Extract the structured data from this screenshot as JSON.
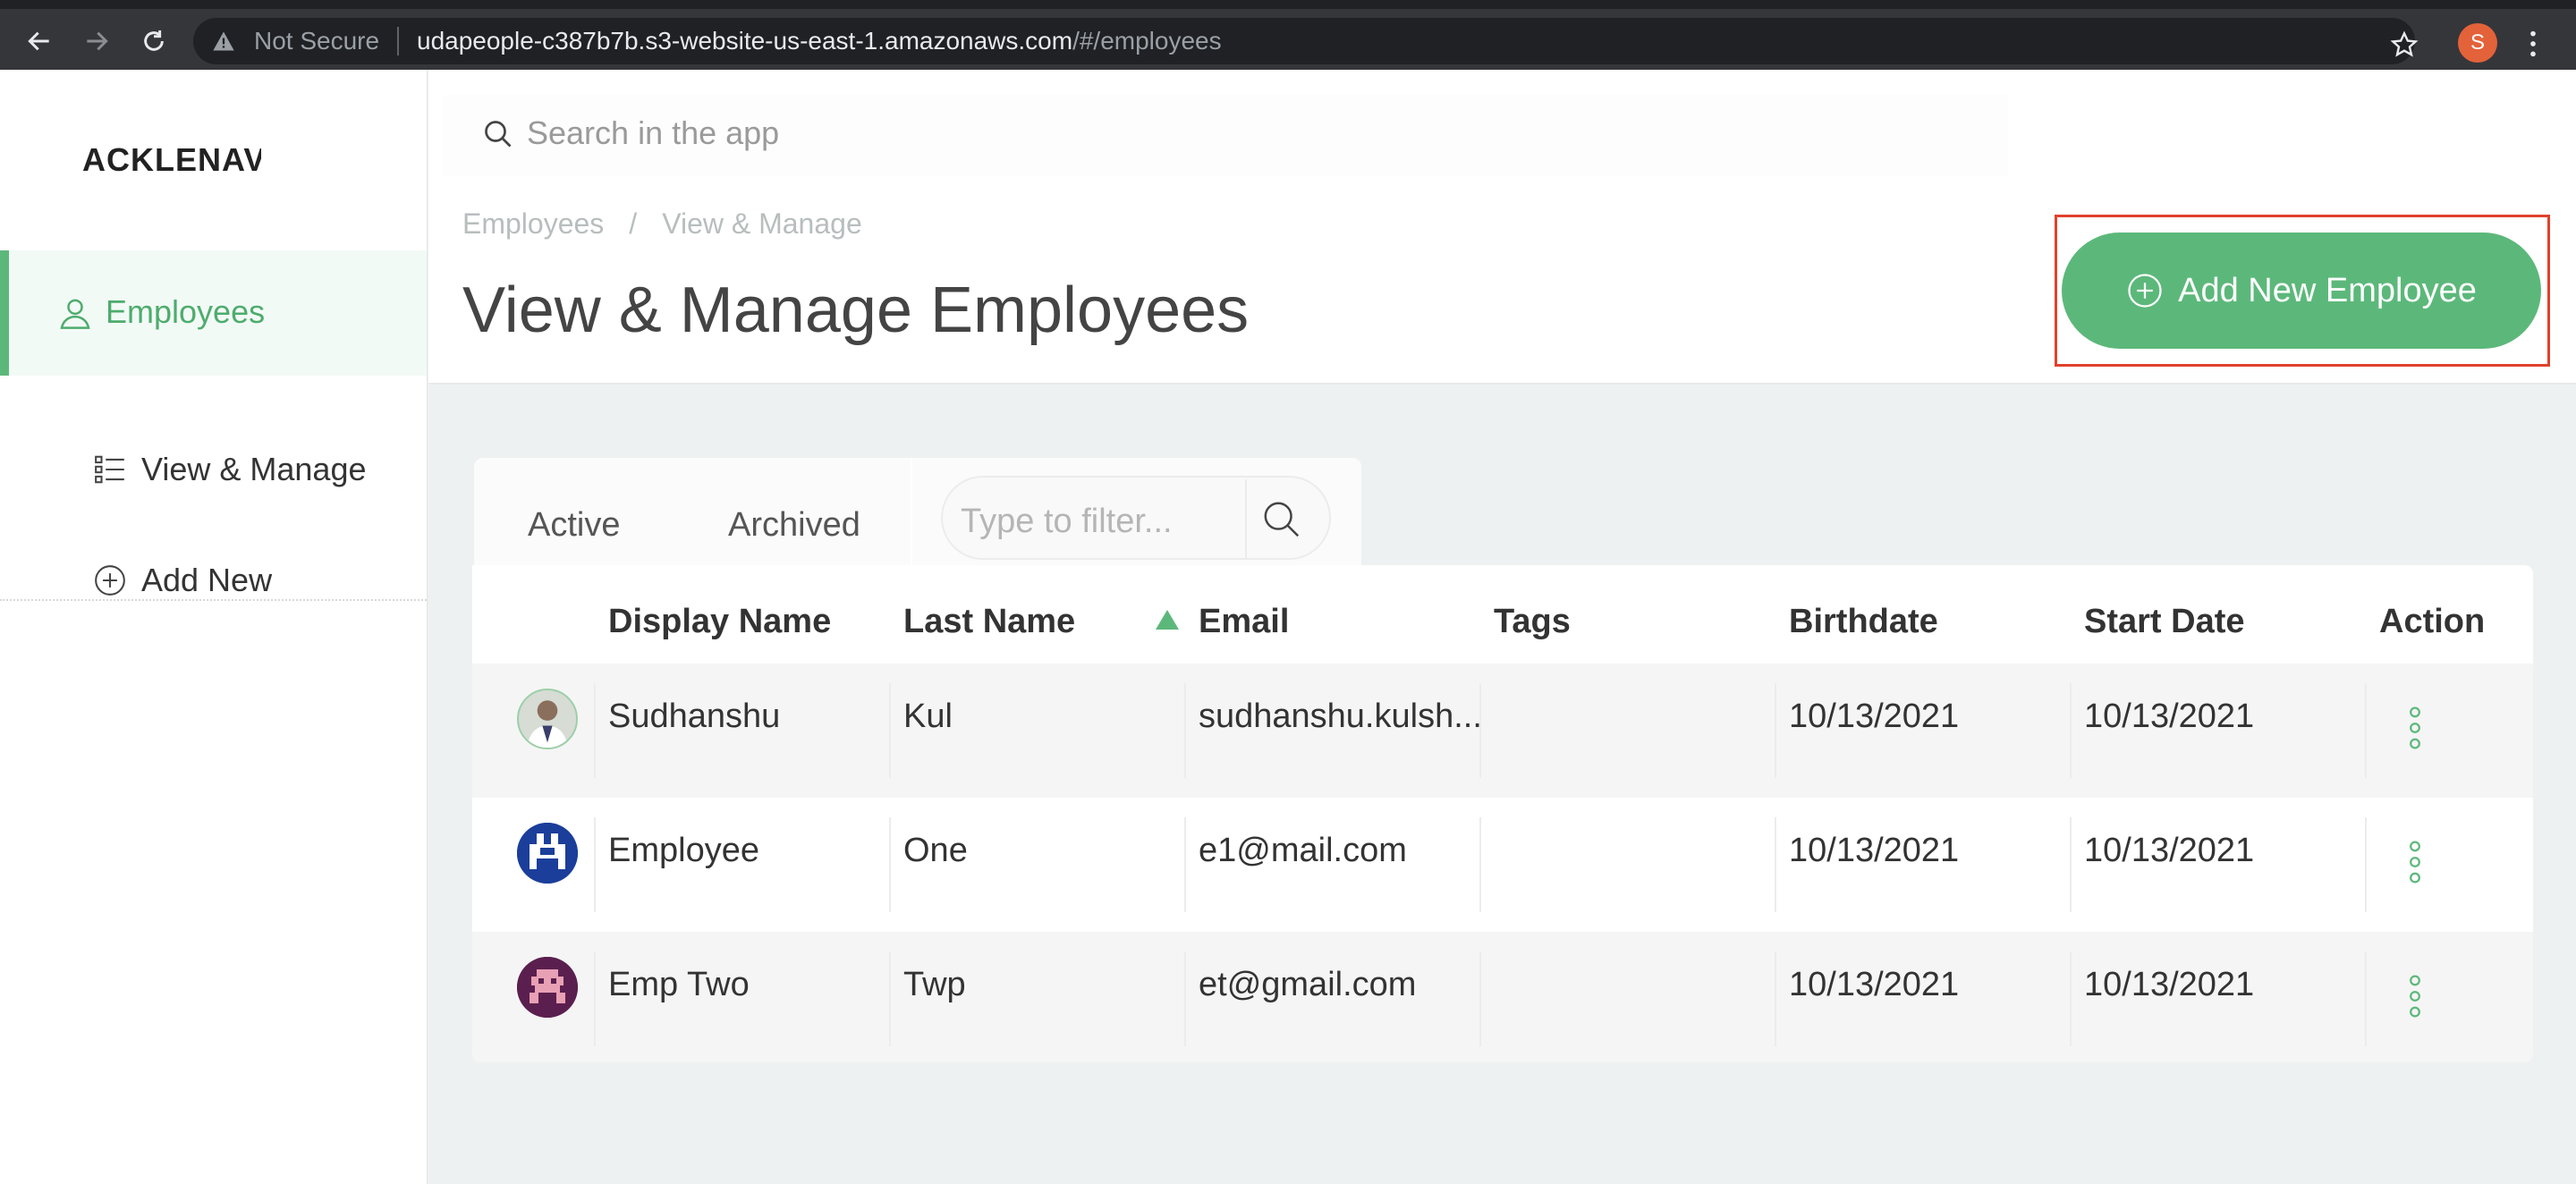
{
  "browser": {
    "not_secure": "Not Secure",
    "url_host": "udapeople-c387b7b.s3-website-us-east-1.amazonaws.com",
    "url_path": "/#/employees",
    "profile_initial": "S"
  },
  "sidebar": {
    "logo": "ACKLENAVENUE",
    "items": [
      {
        "label": "Employees"
      },
      {
        "label": "View & Manage"
      },
      {
        "label": "Add New"
      }
    ]
  },
  "header": {
    "search_placeholder": "Search in the app",
    "breadcrumb": [
      "Employees",
      "/",
      "View & Manage"
    ],
    "title": "View & Manage Employees",
    "add_button": "Add New Employee"
  },
  "tabs": {
    "active": "Active",
    "archived": "Archived",
    "filter_placeholder": "Type to filter..."
  },
  "table": {
    "columns": [
      "Display Name",
      "Last Name",
      "Email",
      "Tags",
      "Birthdate",
      "Start Date",
      "Action"
    ],
    "rows": [
      {
        "display_name": "Sudhanshu",
        "last_name": "Kul",
        "email": "sudhanshu.kulsh...",
        "tags": "",
        "birthdate": "10/13/2021",
        "start_date": "10/13/2021"
      },
      {
        "display_name": "Employee",
        "last_name": "One",
        "email": "e1@mail.com",
        "tags": "",
        "birthdate": "10/13/2021",
        "start_date": "10/13/2021"
      },
      {
        "display_name": "Emp Two",
        "last_name": "Twp",
        "email": "et@gmail.com",
        "tags": "",
        "birthdate": "10/13/2021",
        "start_date": "10/13/2021"
      }
    ]
  },
  "colors": {
    "accent": "#5cb87a",
    "highlight_box": "#e0412c"
  }
}
